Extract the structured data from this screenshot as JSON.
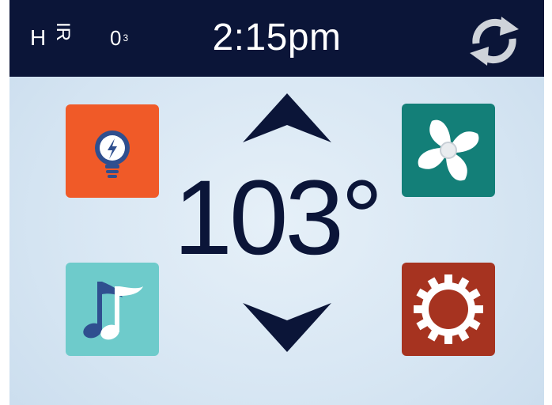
{
  "header": {
    "status": {
      "heater_label": "H",
      "ir_label": "IR",
      "ozone_label": "0",
      "ozone_subscript": "3"
    },
    "clock": "2:15pm",
    "sync_icon": "sync-arrows-icon"
  },
  "main": {
    "temperature": "103°",
    "up_icon": "chevron-up-icon",
    "down_icon": "chevron-down-icon",
    "tiles": [
      {
        "name": "light",
        "icon": "lightbulb-icon",
        "color": "#f05a28"
      },
      {
        "name": "fan",
        "icon": "fan-icon",
        "color": "#137f78"
      },
      {
        "name": "music",
        "icon": "music-note-icon",
        "color": "#6ecbcb"
      },
      {
        "name": "settings",
        "icon": "gear-icon",
        "color": "#a63320"
      }
    ]
  },
  "colors": {
    "header_bg": "#0b1538",
    "panel_bg": "#d7e6f3",
    "text_dark": "#0b1538"
  }
}
